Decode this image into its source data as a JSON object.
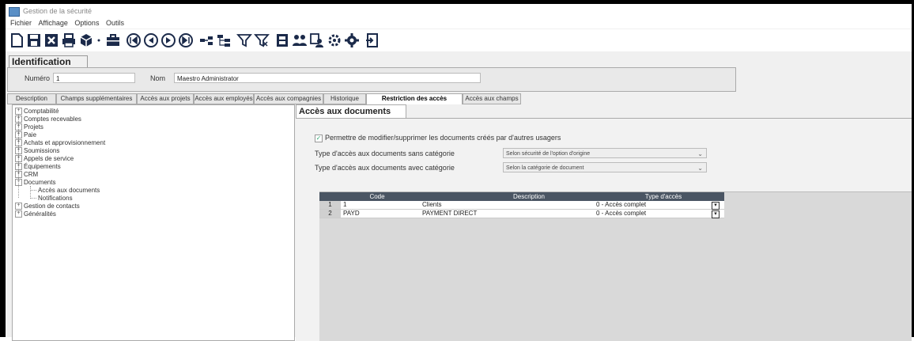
{
  "window": {
    "title": "Gestion de la sécurité"
  },
  "menu": [
    "Fichier",
    "Affichage",
    "Options",
    "Outils"
  ],
  "toolbar": {
    "icons": [
      "new-icon",
      "save-icon",
      "delete-icon",
      "print-icon",
      "package-icon",
      "toolbox-icon",
      "first-icon",
      "previous-icon",
      "next-icon",
      "last-icon",
      "link-icon",
      "hierarchy-icon",
      "filter-icon",
      "clear-filter-icon",
      "calendar-icon",
      "users-icon",
      "copy-user-icon",
      "settings-icon",
      "gear-icon",
      "exit-icon"
    ]
  },
  "identification": {
    "title": "Identification",
    "numero_label": "Numéro",
    "numero_value": "1",
    "nom_label": "Nom",
    "nom_value": "Maestro Administrator"
  },
  "tabs": [
    "Description",
    "Champs supplémentaires",
    "Accès aux projets",
    "Accès aux employés",
    "Accès aux compagnies",
    "Historique",
    "Restriction des accès",
    "Accès aux champs"
  ],
  "active_tab": "Restriction des accès",
  "tree": {
    "items": [
      "Comptabilité",
      "Comptes recevables",
      "Projets",
      "Paie",
      "Achats et approvisionnement",
      "Soumissions",
      "Appels de service",
      "Équipements",
      "CRM",
      "Documents"
    ],
    "children": [
      "Accès aux documents",
      "Notifications"
    ],
    "items_after": [
      "Gestion de contacts",
      "Généralités"
    ]
  },
  "panel": {
    "title": "Accès aux documents",
    "checkbox_label": "Permettre de modifier/supprimer les documents créés par d'autres usagers",
    "sans_cat_label": "Type d'accès aux documents sans catégorie",
    "sans_cat_value": "Selon sécurité de l'option d'origine",
    "avec_cat_label": "Type d'accès aux documents avec catégorie",
    "avec_cat_value": "Selon la catégorie de document"
  },
  "grid": {
    "columns": [
      "Code",
      "Description",
      "Type d'accès"
    ],
    "rows": [
      {
        "num": "1",
        "code": "1",
        "description": "Clients",
        "type": "0 - Accès complet"
      },
      {
        "num": "2",
        "code": "PAYD",
        "description": "PAYMENT DIRECT",
        "type": "0 - Accès complet"
      }
    ]
  },
  "colors": {
    "grid_header": "#4a5563",
    "accent": "#3a7"
  }
}
